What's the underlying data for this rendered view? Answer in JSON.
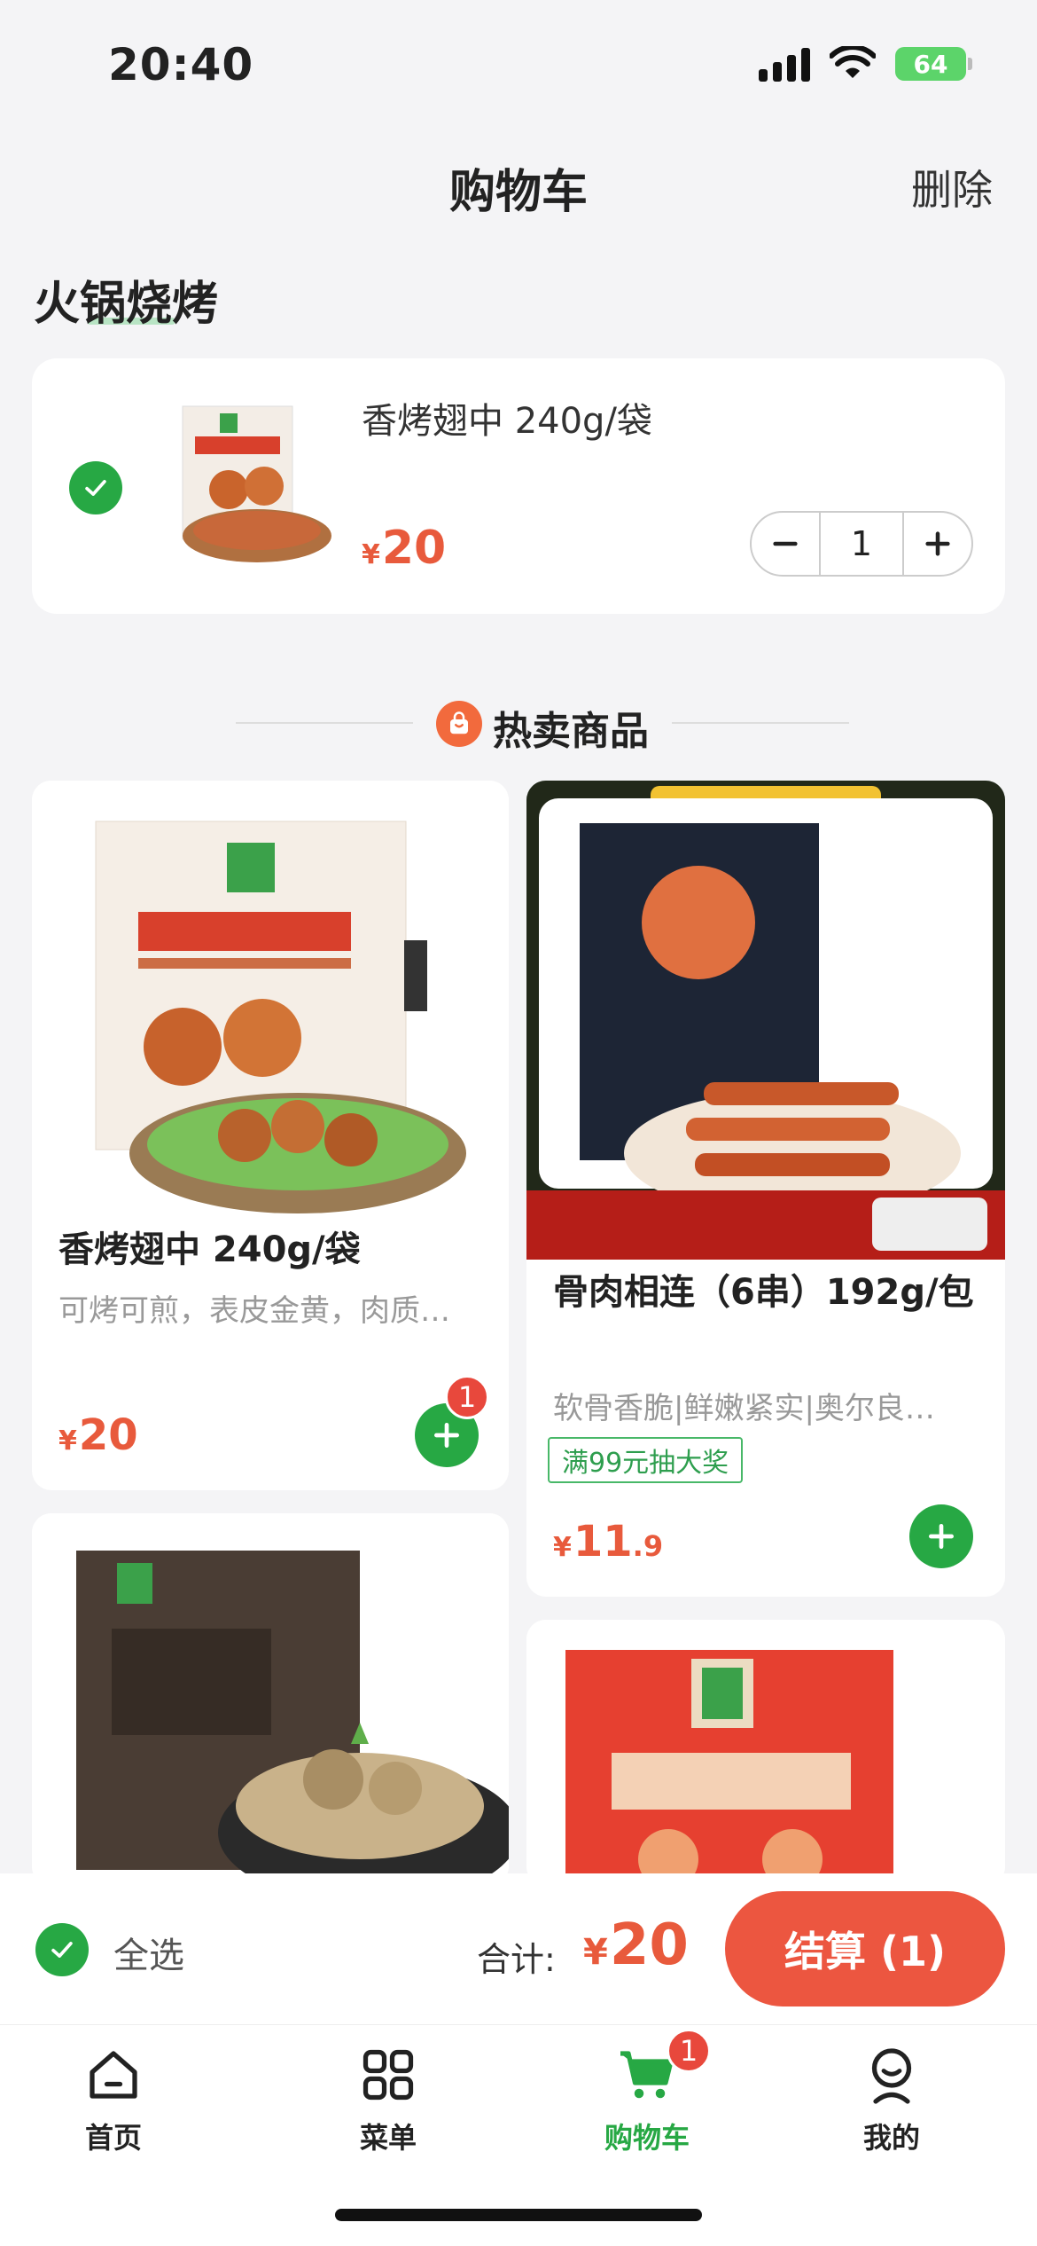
{
  "status": {
    "time": "20:40",
    "battery": "64"
  },
  "nav": {
    "title": "购物车",
    "delete_label": "删除"
  },
  "store": {
    "name": "火锅烧烤"
  },
  "cart_item": {
    "name": "香烤翅中 240g/袋",
    "currency": "¥",
    "price": "20",
    "quantity": "1"
  },
  "hot_section": {
    "title": "热卖商品"
  },
  "products": [
    {
      "name": "香烤翅中 240g/袋",
      "desc": "可烤可煎，表皮金黄，肉质…",
      "currency": "¥",
      "price": "20",
      "price_dec": "",
      "badge": "1"
    },
    {
      "name": "骨肉相连（6串）192g/包",
      "desc": "软骨香脆|鲜嫩紧实|奥尔良…",
      "tag": "满99元抽大奖",
      "currency": "¥",
      "price": "11",
      "price_dec": ".9"
    }
  ],
  "checkout": {
    "select_all": "全选",
    "total_label": "合计:",
    "currency": "¥",
    "total": "20",
    "pay_label": "结算 (1)"
  },
  "tabs": [
    {
      "label": "首页",
      "icon": "home-icon"
    },
    {
      "label": "菜单",
      "icon": "grid-icon"
    },
    {
      "label": "购物车",
      "icon": "cart-icon",
      "badge": "1",
      "active": true
    },
    {
      "label": "我的",
      "icon": "profile-icon"
    }
  ],
  "colors": {
    "accent_green": "#27a844",
    "price_red": "#e85a3c",
    "pay_button": "#ec5640"
  }
}
